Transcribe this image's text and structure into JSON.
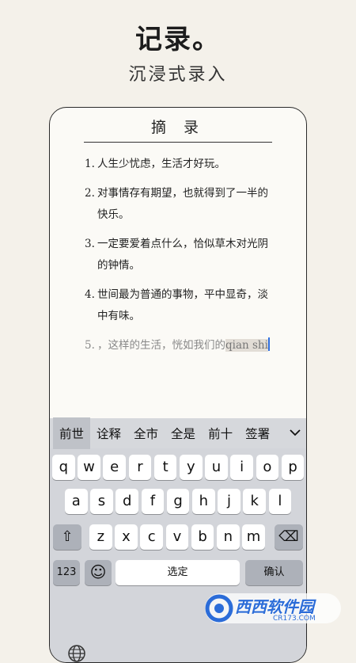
{
  "hero": {
    "title": "记录。",
    "subtitle": "沉浸式录入"
  },
  "document": {
    "title": "摘 录",
    "entries": [
      {
        "num": "1.",
        "text": "人生少忧虑，生活才好玩。"
      },
      {
        "num": "2.",
        "text": "对事情存有期望，也就得到了一半的快乐。"
      },
      {
        "num": "3.",
        "text": "一定要爱着点什么，恰似草木对光阴的钟情。"
      },
      {
        "num": "4.",
        "text": "世间最为普通的事物，平中显奇，淡中有味。"
      }
    ],
    "active_entry": {
      "num": "5.",
      "text": "，这样的生活，恍如我们的",
      "composing": "qian shi"
    }
  },
  "keyboard": {
    "candidates": [
      "前世",
      "诠释",
      "全市",
      "全是",
      "前十",
      "签署"
    ],
    "row1": [
      "q",
      "w",
      "e",
      "r",
      "t",
      "y",
      "u",
      "i",
      "o",
      "p"
    ],
    "row2": [
      "a",
      "s",
      "d",
      "f",
      "g",
      "h",
      "j",
      "k",
      "l"
    ],
    "row3": [
      "z",
      "x",
      "c",
      "v",
      "b",
      "n",
      "m"
    ],
    "shift_glyph": "⇧",
    "backspace_glyph": "⌫",
    "numbers_label": "123",
    "emoji_glyph": "☺",
    "space_label": "选定",
    "confirm_label": "确认"
  },
  "watermark": {
    "text": "西西软件园",
    "url": "CR173.COM"
  }
}
